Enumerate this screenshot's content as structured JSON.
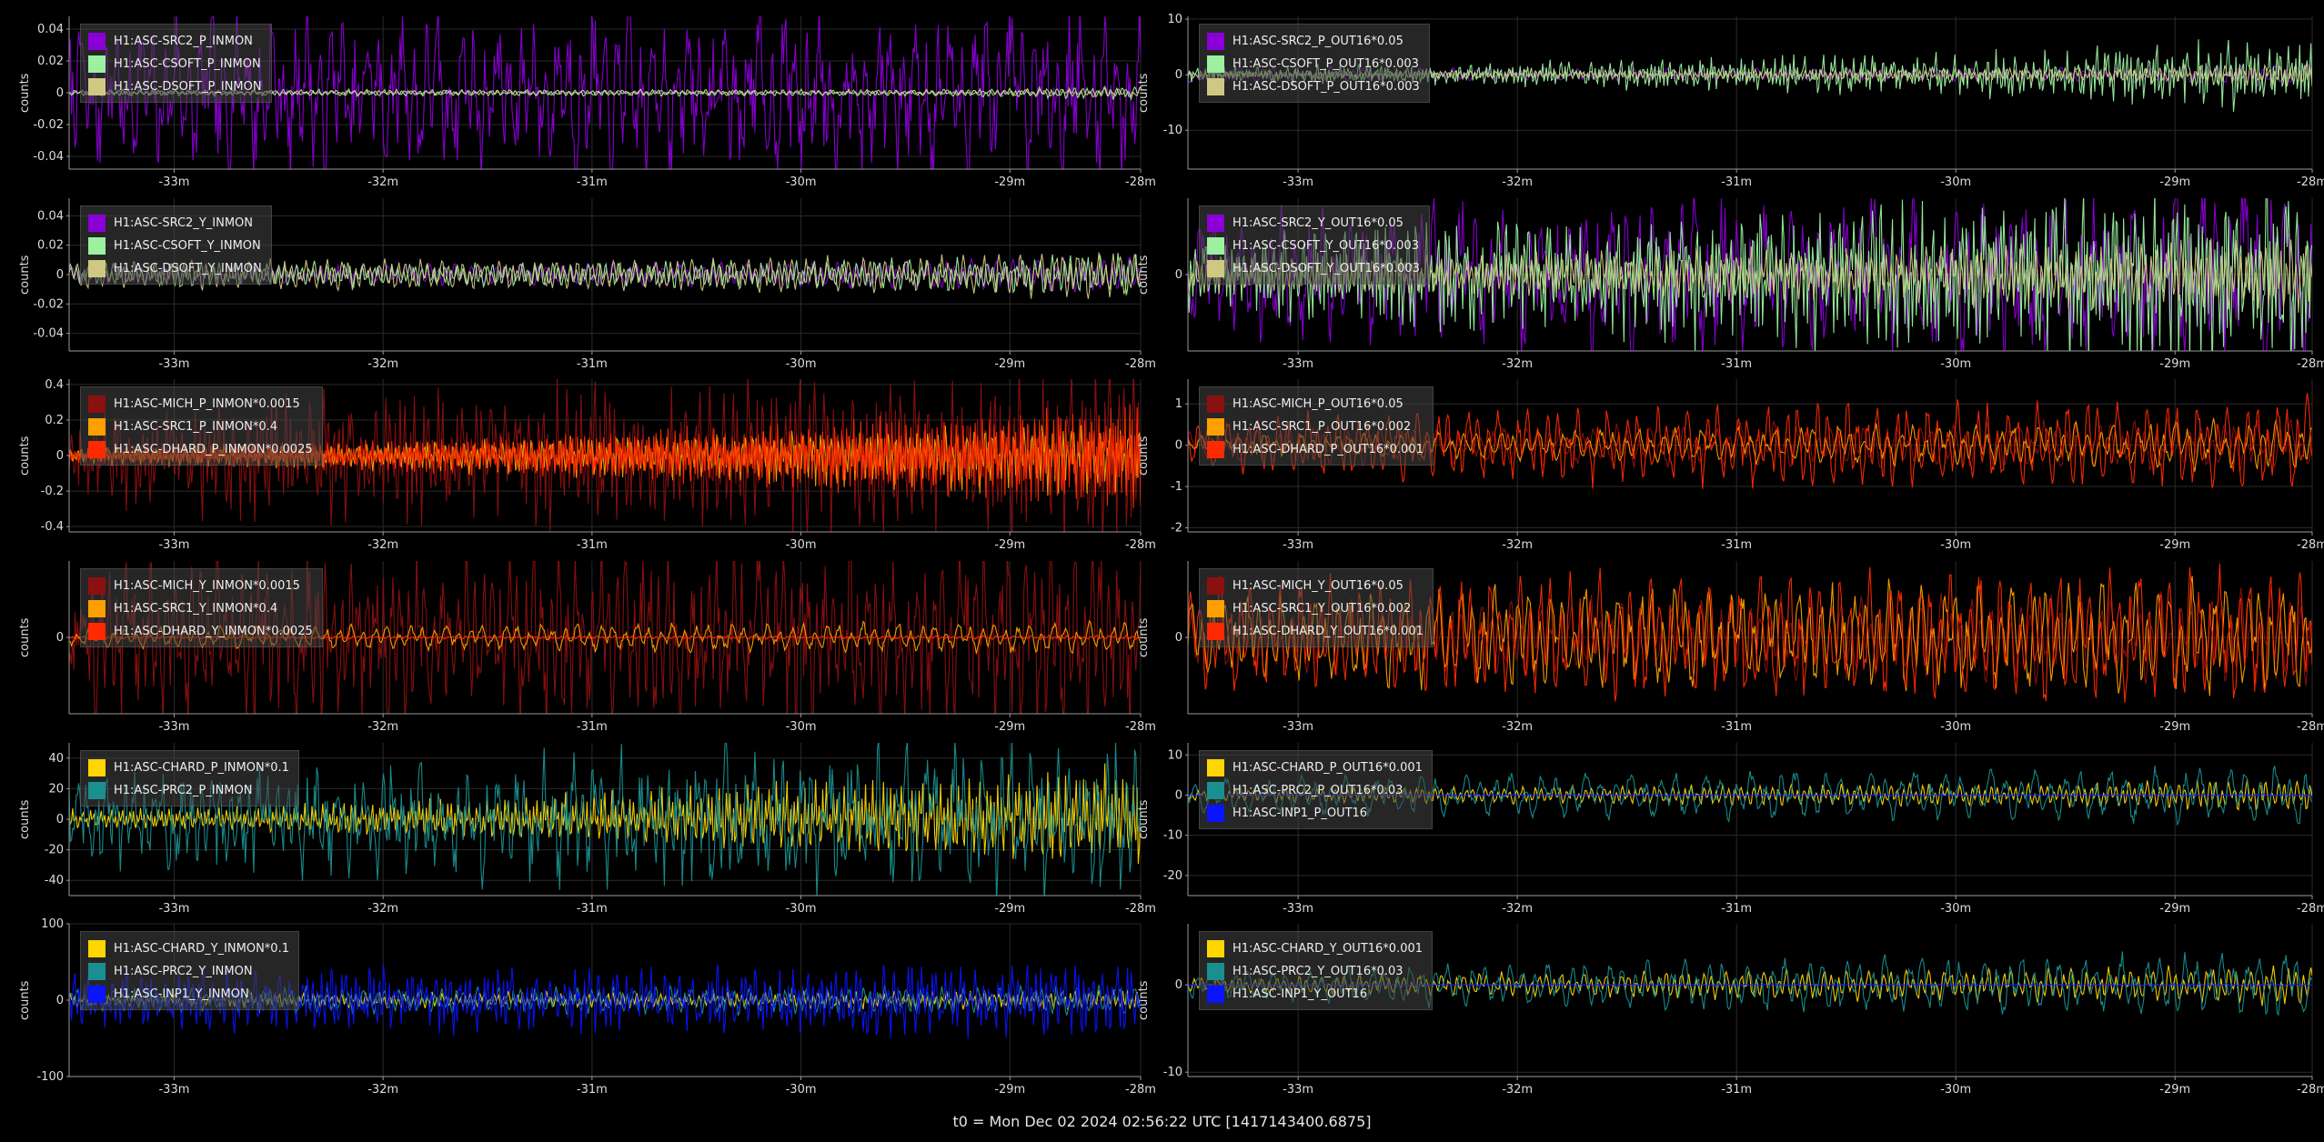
{
  "footer": "t0 = Mon Dec 02 2024 02:56:22 UTC [1417143400.6875]",
  "colors": {
    "background": "#000000",
    "grid": "#2a2a2a",
    "axis": "#9a9a9a",
    "text": "#dddddd"
  },
  "chart_data": [
    {
      "type": "line",
      "ylabel": "counts",
      "ylim": [
        -0.048,
        0.048
      ],
      "yticks": [
        "0.04",
        "0.02",
        "0",
        "-0.02",
        "-0.04"
      ],
      "ytick_values": [
        0.04,
        0.02,
        0,
        -0.02,
        -0.04
      ],
      "x": [
        "-33m",
        "-32m",
        "-31m",
        "-30m",
        "-29m",
        "-28m"
      ],
      "series": [
        {
          "name": "H1:ASC-SRC2_P_INMON",
          "color": "#8b00d6",
          "amp": [
            0.035,
            0.038,
            0.036,
            0.039,
            0.04,
            0.045
          ],
          "period": 10,
          "spiky": true
        },
        {
          "name": "H1:ASC-CSOFT_P_INMON",
          "color": "#9cf0a0",
          "amp": [
            0.002,
            0.002,
            0.002,
            0.002,
            0.002,
            0.004
          ],
          "period": 5
        },
        {
          "name": "H1:ASC-DSOFT_P_INMON",
          "color": "#cfc883",
          "amp": [
            0.0015,
            0.0015,
            0.0015,
            0.0015,
            0.0015,
            0.003
          ],
          "period": 6
        }
      ]
    },
    {
      "type": "line",
      "ylabel": "counts",
      "ylim": [
        -17,
        10.5
      ],
      "yticks": [
        "10",
        "0",
        "-10"
      ],
      "ytick_values": [
        10,
        0,
        -10
      ],
      "x": [
        "-33m",
        "-32m",
        "-31m",
        "-30m",
        "-29m",
        "-28m"
      ],
      "series": [
        {
          "name": "H1:ASC-SRC2_P_OUT16*0.05",
          "color": "#8b00d6",
          "amp": [
            1.5,
            1.2,
            1.0,
            1.0,
            1.2,
            2.0
          ],
          "period": 9
        },
        {
          "name": "H1:ASC-CSOFT_P_OUT16*0.003",
          "color": "#9cf0a0",
          "amp": [
            1.2,
            1.5,
            2.0,
            2.6,
            3.4,
            5.0
          ],
          "period": 3,
          "spiky": true
        },
        {
          "name": "H1:ASC-DSOFT_P_OUT16*0.003",
          "color": "#cfc883",
          "amp": [
            0.6,
            0.7,
            0.8,
            1.0,
            1.2,
            2.0
          ],
          "period": 4
        }
      ]
    },
    {
      "type": "line",
      "ylabel": "counts",
      "ylim": [
        -0.052,
        0.052
      ],
      "yticks": [
        "0.04",
        "0.02",
        "0",
        "-0.02",
        "-0.04"
      ],
      "ytick_values": [
        0.04,
        0.02,
        0,
        -0.02,
        -0.04
      ],
      "x": [
        "-33m",
        "-32m",
        "-31m",
        "-30m",
        "-29m",
        "-28m"
      ],
      "series": [
        {
          "name": "H1:ASC-SRC2_Y_INMON",
          "color": "#8b00d6",
          "amp": [
            0.006,
            0.006,
            0.007,
            0.008,
            0.009,
            0.012
          ],
          "period": 7
        },
        {
          "name": "H1:ASC-CSOFT_Y_INMON",
          "color": "#9cf0a0",
          "amp": [
            0.007,
            0.008,
            0.008,
            0.009,
            0.01,
            0.014
          ],
          "period": 5
        },
        {
          "name": "H1:ASC-DSOFT_Y_INMON",
          "color": "#cfc883",
          "amp": [
            0.009,
            0.01,
            0.01,
            0.011,
            0.012,
            0.016
          ],
          "period": 6
        }
      ]
    },
    {
      "type": "line",
      "ylabel": "counts",
      "ylim": [
        -1.0,
        1.0
      ],
      "yticks": [
        "0"
      ],
      "ytick_values": [
        0
      ],
      "x": [
        "-33m",
        "-32m",
        "-31m",
        "-30m",
        "-29m",
        "-28m"
      ],
      "series": [
        {
          "name": "H1:ASC-SRC2_Y_OUT16*0.05",
          "color": "#8b00d6",
          "amp": [
            0.6,
            0.7,
            0.8,
            0.8,
            0.8,
            0.9
          ],
          "period": 11,
          "spiky": true
        },
        {
          "name": "H1:ASC-CSOFT_Y_OUT16*0.003",
          "color": "#9cf0a0",
          "amp": [
            0.4,
            0.55,
            0.65,
            0.75,
            0.85,
            0.95
          ],
          "period": 3,
          "spiky": true
        },
        {
          "name": "H1:ASC-DSOFT_Y_OUT16*0.003",
          "color": "#cfc883",
          "amp": [
            0.2,
            0.25,
            0.3,
            0.35,
            0.4,
            0.45
          ],
          "period": 4
        }
      ]
    },
    {
      "type": "line",
      "ylabel": "counts",
      "ylim": [
        -0.43,
        0.43
      ],
      "yticks": [
        "0.4",
        "0.2",
        "0",
        "-0.2",
        "-0.4"
      ],
      "ytick_values": [
        0.4,
        0.2,
        0,
        -0.2,
        -0.4
      ],
      "x": [
        "-33m",
        "-32m",
        "-31m",
        "-30m",
        "-29m",
        "-28m"
      ],
      "series": [
        {
          "name": "H1:ASC-MICH_P_INMON*0.0015",
          "color": "#8b1010",
          "amp": [
            0.2,
            0.25,
            0.28,
            0.3,
            0.32,
            0.35
          ],
          "period": 4,
          "spiky": true
        },
        {
          "name": "H1:ASC-SRC1_P_INMON*0.4",
          "color": "#ffa000",
          "amp": [
            0.05,
            0.07,
            0.1,
            0.14,
            0.18,
            0.22
          ],
          "period": 3
        },
        {
          "name": "H1:ASC-DHARD_P_INMON*0.0025",
          "color": "#ff2a00",
          "amp": [
            0.04,
            0.07,
            0.11,
            0.16,
            0.22,
            0.3
          ],
          "period": 2
        }
      ]
    },
    {
      "type": "line",
      "ylabel": "counts",
      "ylim": [
        -2.1,
        1.6
      ],
      "yticks": [
        "1",
        "0",
        "-1",
        "-2"
      ],
      "ytick_values": [
        1,
        0,
        -1,
        -2
      ],
      "x": [
        "-33m",
        "-32m",
        "-31m",
        "-30m",
        "-29m",
        "-28m"
      ],
      "series": [
        {
          "name": "H1:ASC-MICH_P_OUT16*0.05",
          "color": "#8b1010",
          "amp": [
            0.4,
            0.45,
            0.5,
            0.5,
            0.55,
            0.6
          ],
          "period": 9
        },
        {
          "name": "H1:ASC-SRC1_P_OUT16*0.002",
          "color": "#ffa000",
          "amp": [
            0.2,
            0.3,
            0.4,
            0.45,
            0.5,
            0.6
          ],
          "period": 10
        },
        {
          "name": "H1:ASC-DHARD_P_OUT16*0.001",
          "color": "#ff2a00",
          "amp": [
            0.6,
            0.8,
            0.9,
            1.0,
            1.0,
            1.1
          ],
          "period": 8
        }
      ]
    },
    {
      "type": "line",
      "ylabel": "counts",
      "ylim": [
        -1.0,
        1.0
      ],
      "yticks": [
        "0"
      ],
      "ytick_values": [
        0
      ],
      "x": [
        "-33m",
        "-32m",
        "-31m",
        "-30m",
        "-29m",
        "-28m"
      ],
      "series": [
        {
          "name": "H1:ASC-MICH_Y_INMON*0.0015",
          "color": "#8b1010",
          "amp": [
            0.8,
            0.85,
            0.85,
            0.9,
            0.9,
            0.9
          ],
          "period": 7,
          "spiky": true
        },
        {
          "name": "H1:ASC-SRC1_Y_INMON*0.4",
          "color": "#ffa000",
          "amp": [
            0.12,
            0.14,
            0.16,
            0.18,
            0.18,
            0.2
          ],
          "period": 10
        },
        {
          "name": "H1:ASC-DHARD_Y_INMON*0.0025",
          "color": "#ff2a00",
          "amp": [
            0.02,
            0.02,
            0.02,
            0.02,
            0.02,
            0.03
          ],
          "period": 5
        }
      ]
    },
    {
      "type": "line",
      "ylabel": "counts",
      "ylim": [
        -1.0,
        1.0
      ],
      "yticks": [
        "0"
      ],
      "ytick_values": [
        0
      ],
      "x": [
        "-33m",
        "-32m",
        "-31m",
        "-30m",
        "-29m",
        "-28m"
      ],
      "series": [
        {
          "name": "H1:ASC-MICH_Y_OUT16*0.05",
          "color": "#8b1010",
          "amp": [
            0.4,
            0.45,
            0.5,
            0.5,
            0.55,
            0.6
          ],
          "period": 8
        },
        {
          "name": "H1:ASC-SRC1_Y_OUT16*0.002",
          "color": "#ffa000",
          "amp": [
            0.5,
            0.6,
            0.65,
            0.65,
            0.7,
            0.7
          ],
          "period": 9
        },
        {
          "name": "H1:ASC-DHARD_Y_OUT16*0.001",
          "color": "#ff2a00",
          "amp": [
            0.7,
            0.75,
            0.8,
            0.8,
            0.85,
            0.85
          ],
          "period": 8
        }
      ]
    },
    {
      "type": "line",
      "ylabel": "counts",
      "ylim": [
        -50,
        50
      ],
      "yticks": [
        "40",
        "20",
        "0",
        "-20",
        "-40"
      ],
      "ytick_values": [
        40,
        20,
        0,
        -20,
        -40
      ],
      "x": [
        "-33m",
        "-32m",
        "-31m",
        "-30m",
        "-29m",
        "-28m"
      ],
      "series": [
        {
          "name": "H1:ASC-CHARD_P_INMON*0.1",
          "color": "#ffd600",
          "amp": [
            6,
            9,
            14,
            20,
            26,
            32
          ],
          "period": 3
        },
        {
          "name": "H1:ASC-PRC2_P_INMON",
          "color": "#1a8f8f",
          "amp": [
            22,
            28,
            30,
            34,
            36,
            38
          ],
          "period": 8,
          "spiky": true
        }
      ]
    },
    {
      "type": "line",
      "ylabel": "counts",
      "ylim": [
        -25,
        13
      ],
      "yticks": [
        "10",
        "0",
        "-10",
        "-20"
      ],
      "ytick_values": [
        10,
        0,
        -10,
        -20
      ],
      "x": [
        "-33m",
        "-32m",
        "-31m",
        "-30m",
        "-29m",
        "-28m"
      ],
      "series": [
        {
          "name": "H1:ASC-CHARD_P_OUT16*0.001",
          "color": "#ffd600",
          "amp": [
            1.5,
            2,
            2.2,
            2.5,
            3,
            4
          ],
          "period": 5
        },
        {
          "name": "H1:ASC-PRC2_P_OUT16*0.03",
          "color": "#1a8f8f",
          "amp": [
            4,
            5,
            5.5,
            6,
            6,
            7
          ],
          "period": 12
        },
        {
          "name": "H1:ASC-INP1_P_OUT16",
          "color": "#0a14ff",
          "amp": [
            0.2,
            0.2,
            0.2,
            0.2,
            0.2,
            0.3
          ],
          "period": 6
        }
      ]
    },
    {
      "type": "line",
      "ylabel": "counts",
      "ylim": [
        -100,
        100
      ],
      "yticks": [
        "100",
        "0",
        "-100"
      ],
      "ytick_values": [
        100,
        0,
        -100
      ],
      "x": [
        "-33m",
        "-32m",
        "-31m",
        "-30m",
        "-29m",
        "-28m"
      ],
      "series": [
        {
          "name": "H1:ASC-CHARD_Y_INMON*0.1",
          "color": "#ffd600",
          "amp": [
            8,
            9,
            10,
            10,
            11,
            14
          ],
          "period": 4
        },
        {
          "name": "H1:ASC-PRC2_Y_INMON",
          "color": "#1a8f8f",
          "amp": [
            14,
            16,
            16,
            18,
            18,
            20
          ],
          "period": 6
        },
        {
          "name": "H1:ASC-INP1_Y_INMON",
          "color": "#0a14ff",
          "amp": [
            28,
            32,
            34,
            34,
            36,
            38
          ],
          "period": 4,
          "spiky": true
        }
      ]
    },
    {
      "type": "line",
      "ylabel": "counts",
      "ylim": [
        -10.5,
        7
      ],
      "yticks": [
        "0",
        "-10"
      ],
      "ytick_values": [
        0,
        -10
      ],
      "x": [
        "-33m",
        "-32m",
        "-31m",
        "-30m",
        "-29m",
        "-28m"
      ],
      "series": [
        {
          "name": "H1:ASC-CHARD_Y_OUT16*0.001",
          "color": "#ffd600",
          "amp": [
            0.8,
            1.2,
            1.5,
            1.7,
            1.8,
            2.2
          ],
          "period": 6
        },
        {
          "name": "H1:ASC-PRC2_Y_OUT16*0.03",
          "color": "#1a8f8f",
          "amp": [
            1.5,
            2.2,
            2.6,
            3.0,
            3.2,
            3.6
          ],
          "period": 10
        },
        {
          "name": "H1:ASC-INP1_Y_OUT16",
          "color": "#0a14ff",
          "amp": [
            0.1,
            0.1,
            0.1,
            0.1,
            0.1,
            0.2
          ],
          "period": 7
        }
      ]
    }
  ]
}
